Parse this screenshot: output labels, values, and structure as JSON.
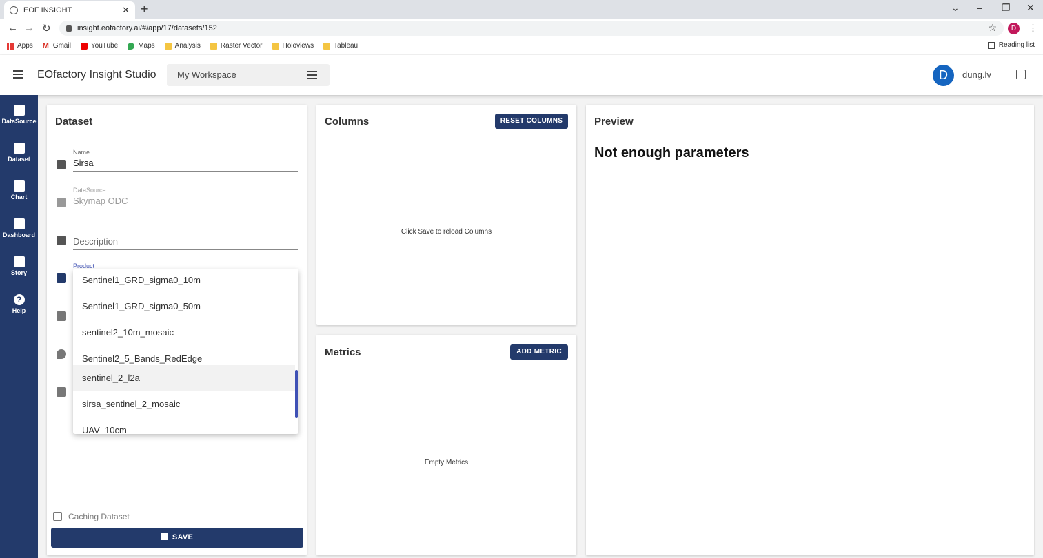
{
  "browser": {
    "tab_title": "EOF INSIGHT",
    "url": "insight.eofactory.ai/#/app/17/datasets/152",
    "profile_initial": "D",
    "bookmarks": [
      "Apps",
      "Gmail",
      "YouTube",
      "Maps",
      "Analysis",
      "Raster Vector",
      "Holoviews",
      "Tableau"
    ],
    "reading_list": "Reading list"
  },
  "header": {
    "app_title": "EOfactory Insight Studio",
    "workspace": "My Workspace",
    "avatar_initial": "D",
    "username": "dung.lv"
  },
  "sidebar": {
    "items": [
      {
        "label": "DataSource"
      },
      {
        "label": "Dataset"
      },
      {
        "label": "Chart"
      },
      {
        "label": "Dashboard"
      },
      {
        "label": "Story"
      },
      {
        "label": "Help"
      }
    ]
  },
  "dataset": {
    "title": "Dataset",
    "name_label": "Name",
    "name_value": "Sirsa",
    "datasource_label": "DataSource",
    "datasource_value": "Skymap ODC",
    "description_placeholder": "Description",
    "product_label": "Product",
    "product_options": [
      "Sentinel1_GRD_sigma0_10m",
      "Sentinel1_GRD_sigma0_50m",
      "sentinel2_10m_mosaic",
      "Sentinel2_5_Bands_RedEdge",
      "sentinel_2_l2a",
      "sirsa_sentinel_2_mosaic",
      "UAV_10cm"
    ],
    "caching_label": "Caching Dataset",
    "save_label": "SAVE"
  },
  "columns": {
    "title": "Columns",
    "reset_label": "RESET COLUMNS",
    "message": "Click Save to reload Columns"
  },
  "metrics": {
    "title": "Metrics",
    "add_label": "ADD METRIC",
    "message": "Empty Metrics"
  },
  "preview": {
    "title": "Preview",
    "message": "Not enough parameters"
  }
}
